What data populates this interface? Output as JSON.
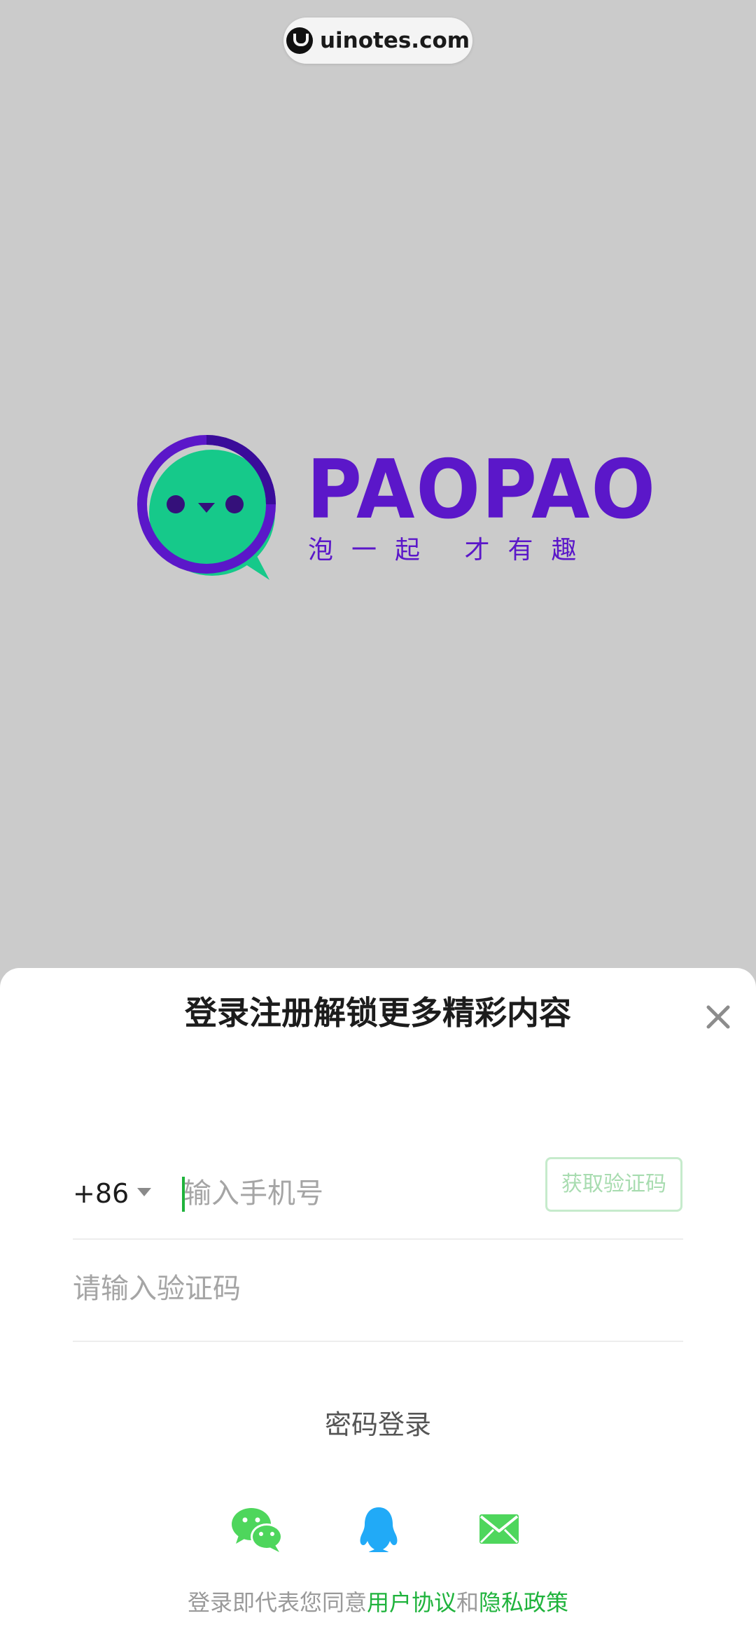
{
  "watermark": {
    "text": "uinotes.com"
  },
  "brand": {
    "name": "PAOPAO",
    "tagline": "泡一起 才有趣"
  },
  "login_sheet": {
    "title": "登录注册解锁更多精彩内容",
    "country_code": "+86",
    "phone_placeholder": "输入手机号",
    "get_code_label": "获取验证码",
    "verify_placeholder": "请输入验证码",
    "password_login_label": "密码登录",
    "social_icons": [
      "wechat-icon",
      "qq-icon",
      "mail-icon"
    ],
    "agreement": {
      "prefix": "登录即代表您同意",
      "user_agreement": "用户协议",
      "and": "和",
      "privacy_policy": "隐私政策"
    }
  },
  "colors": {
    "background": "#cbcbcb",
    "brand_purple": "#5b17c9",
    "brand_green": "#16c98a",
    "accent_green": "#1fb33c",
    "qq_blue": "#21aaf7",
    "mail_green": "#4ed65c"
  }
}
